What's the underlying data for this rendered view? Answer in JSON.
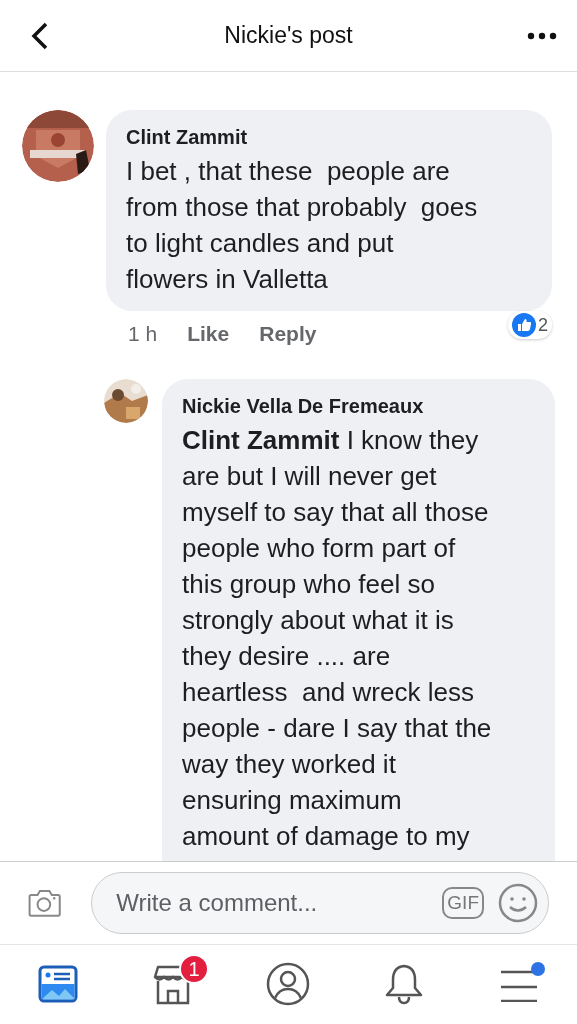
{
  "header": {
    "title": "Nickie's post"
  },
  "comments": [
    {
      "author": "Clint Zammit",
      "lines": [
        "I bet , that these  people are",
        "from those that probably  goes",
        "to light candles and put",
        "flowers in Valletta"
      ],
      "time": "1 h",
      "actions": [
        "Like",
        "Reply"
      ],
      "reactions": "2",
      "replies": [
        {
          "author": "Nickie Vella De Fremeaux",
          "lines": [
            "**Clint Zammit** I know they",
            "are but I will never get",
            "myself to say that all those",
            "people who form part of",
            "this group who feel so",
            "strongly about what it is",
            "they desire .... are",
            "heartless  and wreck less",
            "people - dare I say that the",
            "way they worked it",
            "ensuring maximum",
            "amount of damage to my"
          ]
        }
      ]
    }
  ],
  "composer": {
    "placeholder": "Write a comment...",
    "gif": "GIF"
  },
  "tabs": [
    {
      "kind": "feed",
      "selected": true
    },
    {
      "kind": "store",
      "selected": false,
      "badge": "1"
    },
    {
      "kind": "profile",
      "selected": false
    },
    {
      "kind": "bell",
      "selected": false
    },
    {
      "kind": "menu",
      "selected": false,
      "dot": true
    }
  ]
}
